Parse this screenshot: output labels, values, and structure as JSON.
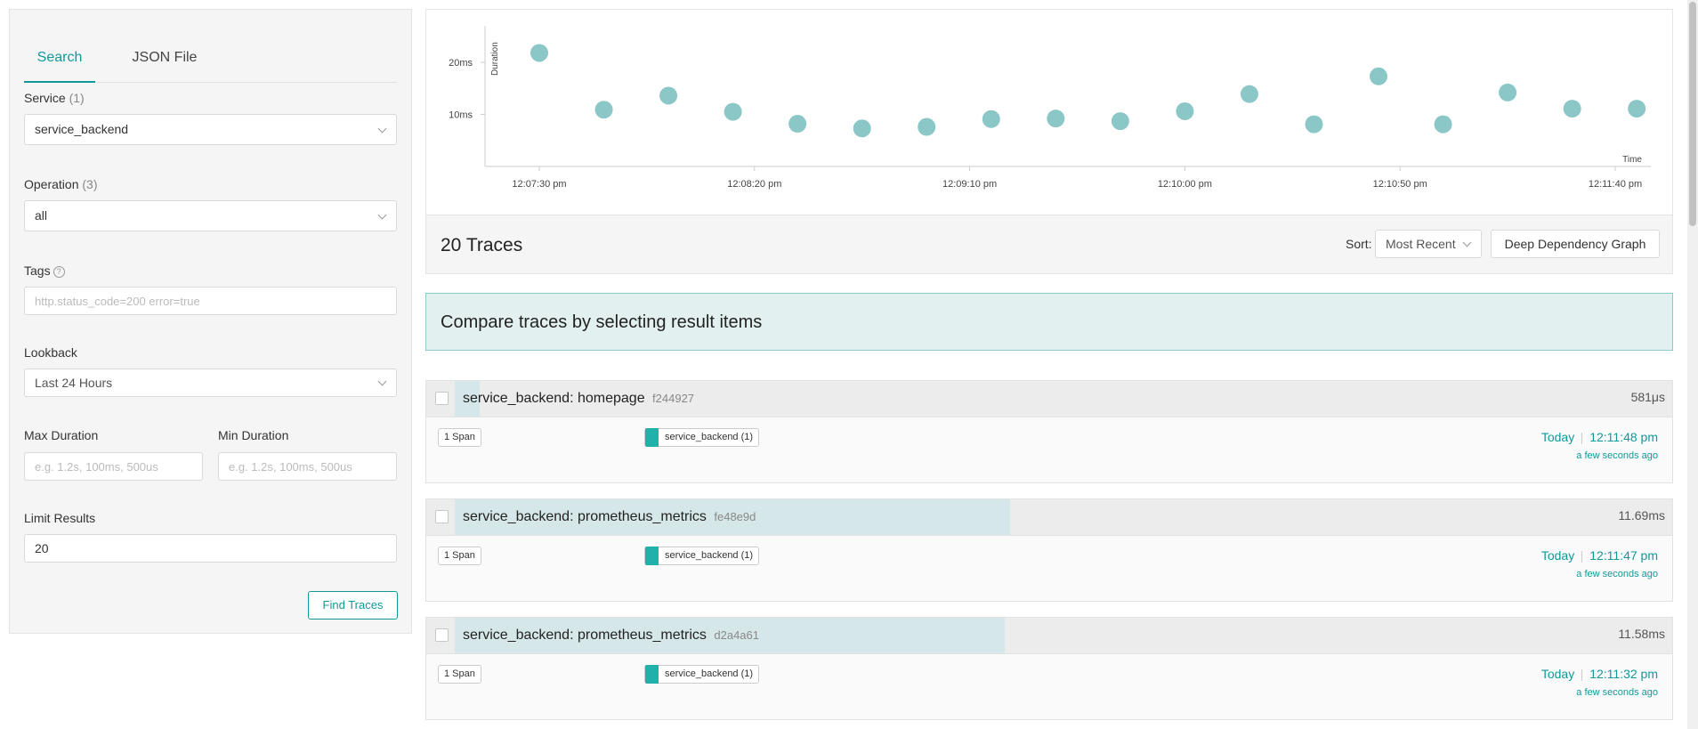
{
  "search_panel": {
    "tabs": [
      {
        "label": "Search",
        "active": true
      },
      {
        "label": "JSON File",
        "active": false
      }
    ],
    "service": {
      "label": "Service",
      "count": "(1)",
      "value": "service_backend"
    },
    "operation": {
      "label": "Operation",
      "count": "(3)",
      "value": "all"
    },
    "tags": {
      "label": "Tags",
      "help": "?",
      "placeholder": "http.status_code=200 error=true"
    },
    "lookback": {
      "label": "Lookback",
      "value": "Last 24 Hours"
    },
    "max_duration": {
      "label": "Max Duration",
      "placeholder": "e.g. 1.2s, 100ms, 500us"
    },
    "min_duration": {
      "label": "Min Duration",
      "placeholder": "e.g. 1.2s, 100ms, 500us"
    },
    "limit": {
      "label": "Limit Results",
      "value": "20"
    },
    "find_button": "Find Traces"
  },
  "chart_data": {
    "type": "scatter",
    "xlabel": "Time",
    "ylabel": "Duration",
    "x_ticks": [
      "12:07:30 pm",
      "12:08:20 pm",
      "12:09:10 pm",
      "12:10:00 pm",
      "12:10:50 pm",
      "12:11:40 pm"
    ],
    "y_ticks": [
      "10ms",
      "20ms"
    ],
    "points": [
      {
        "x": "12:07:30 pm",
        "y": 21.8
      },
      {
        "x": "12:07:45 pm",
        "y": 10.9
      },
      {
        "x": "12:08:00 pm",
        "y": 13.6
      },
      {
        "x": "12:08:15 pm",
        "y": 10.5
      },
      {
        "x": "12:08:30 pm",
        "y": 8.2
      },
      {
        "x": "12:08:45 pm",
        "y": 7.3
      },
      {
        "x": "12:09:00 pm",
        "y": 7.6
      },
      {
        "x": "12:09:15 pm",
        "y": 9.1
      },
      {
        "x": "12:09:30 pm",
        "y": 9.2
      },
      {
        "x": "12:09:45 pm",
        "y": 8.7
      },
      {
        "x": "12:10:00 pm",
        "y": 10.6
      },
      {
        "x": "12:10:15 pm",
        "y": 13.9
      },
      {
        "x": "12:10:30 pm",
        "y": 8.1
      },
      {
        "x": "12:10:45 pm",
        "y": 17.3
      },
      {
        "x": "12:11:00 pm",
        "y": 8.1
      },
      {
        "x": "12:11:15 pm",
        "y": 14.2
      },
      {
        "x": "12:11:30 pm",
        "y": 11.1
      },
      {
        "x": "12:11:45 pm",
        "y": 11.1
      }
    ],
    "color": "#8cc7c8"
  },
  "results": {
    "count_title": "20 Traces",
    "sort_label": "Sort:",
    "sort_value": "Most Recent",
    "ddg_button": "Deep Dependency Graph",
    "compare_text": "Compare traces by selecting result items"
  },
  "traces": [
    {
      "service": "service_backend:",
      "operation": "homepage",
      "id": "f244927",
      "duration": "581μs",
      "duration_fraction": 0.02,
      "spans": "1 Span",
      "service_tag": "service_backend (1)",
      "date": "Today",
      "time": "12:11:48 pm",
      "ago": "a few seconds ago"
    },
    {
      "service": "service_backend:",
      "operation": "prometheus_metrics",
      "id": "fe48e9d",
      "duration": "11.69ms",
      "duration_fraction": 0.445,
      "spans": "1 Span",
      "service_tag": "service_backend (1)",
      "date": "Today",
      "time": "12:11:47 pm",
      "ago": "a few seconds ago"
    },
    {
      "service": "service_backend:",
      "operation": "prometheus_metrics",
      "id": "d2a4a61",
      "duration": "11.58ms",
      "duration_fraction": 0.441,
      "spans": "1 Span",
      "service_tag": "service_backend (1)",
      "date": "Today",
      "time": "12:11:32 pm",
      "ago": "a few seconds ago"
    }
  ]
}
